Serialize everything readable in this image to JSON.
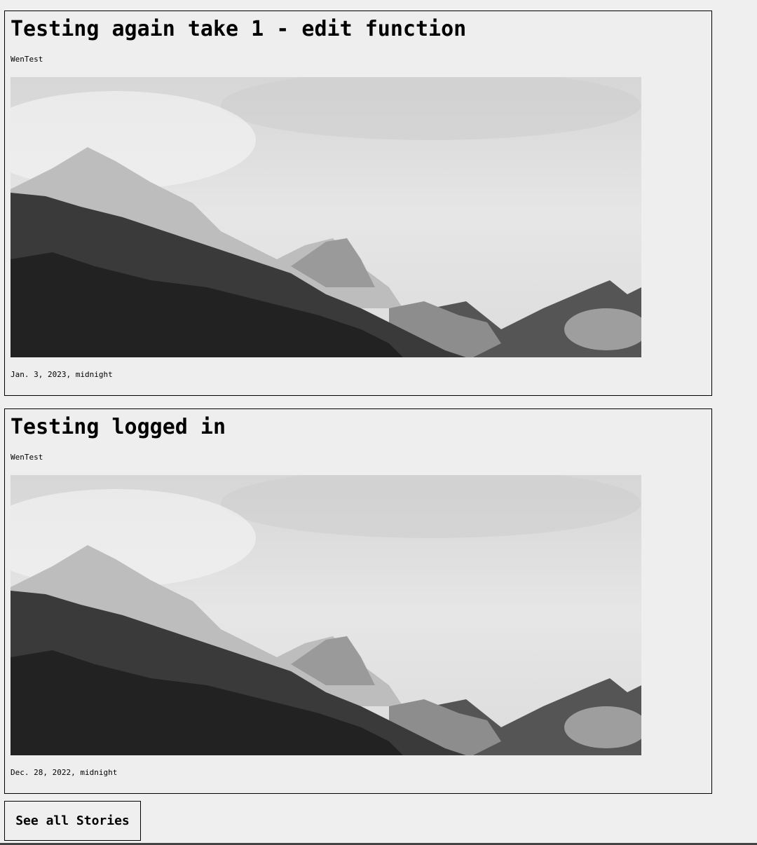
{
  "stories": [
    {
      "title": "Testing again take 1 - edit function",
      "author": "WenTest",
      "date": "Jan. 3, 2023, midnight"
    },
    {
      "title": "Testing logged in",
      "author": "WenTest",
      "date": "Dec. 28, 2022, midnight"
    }
  ],
  "see_all_label": "See all Stories",
  "colors": {
    "background": "#efefef",
    "border": "#000000",
    "text": "#000000"
  }
}
